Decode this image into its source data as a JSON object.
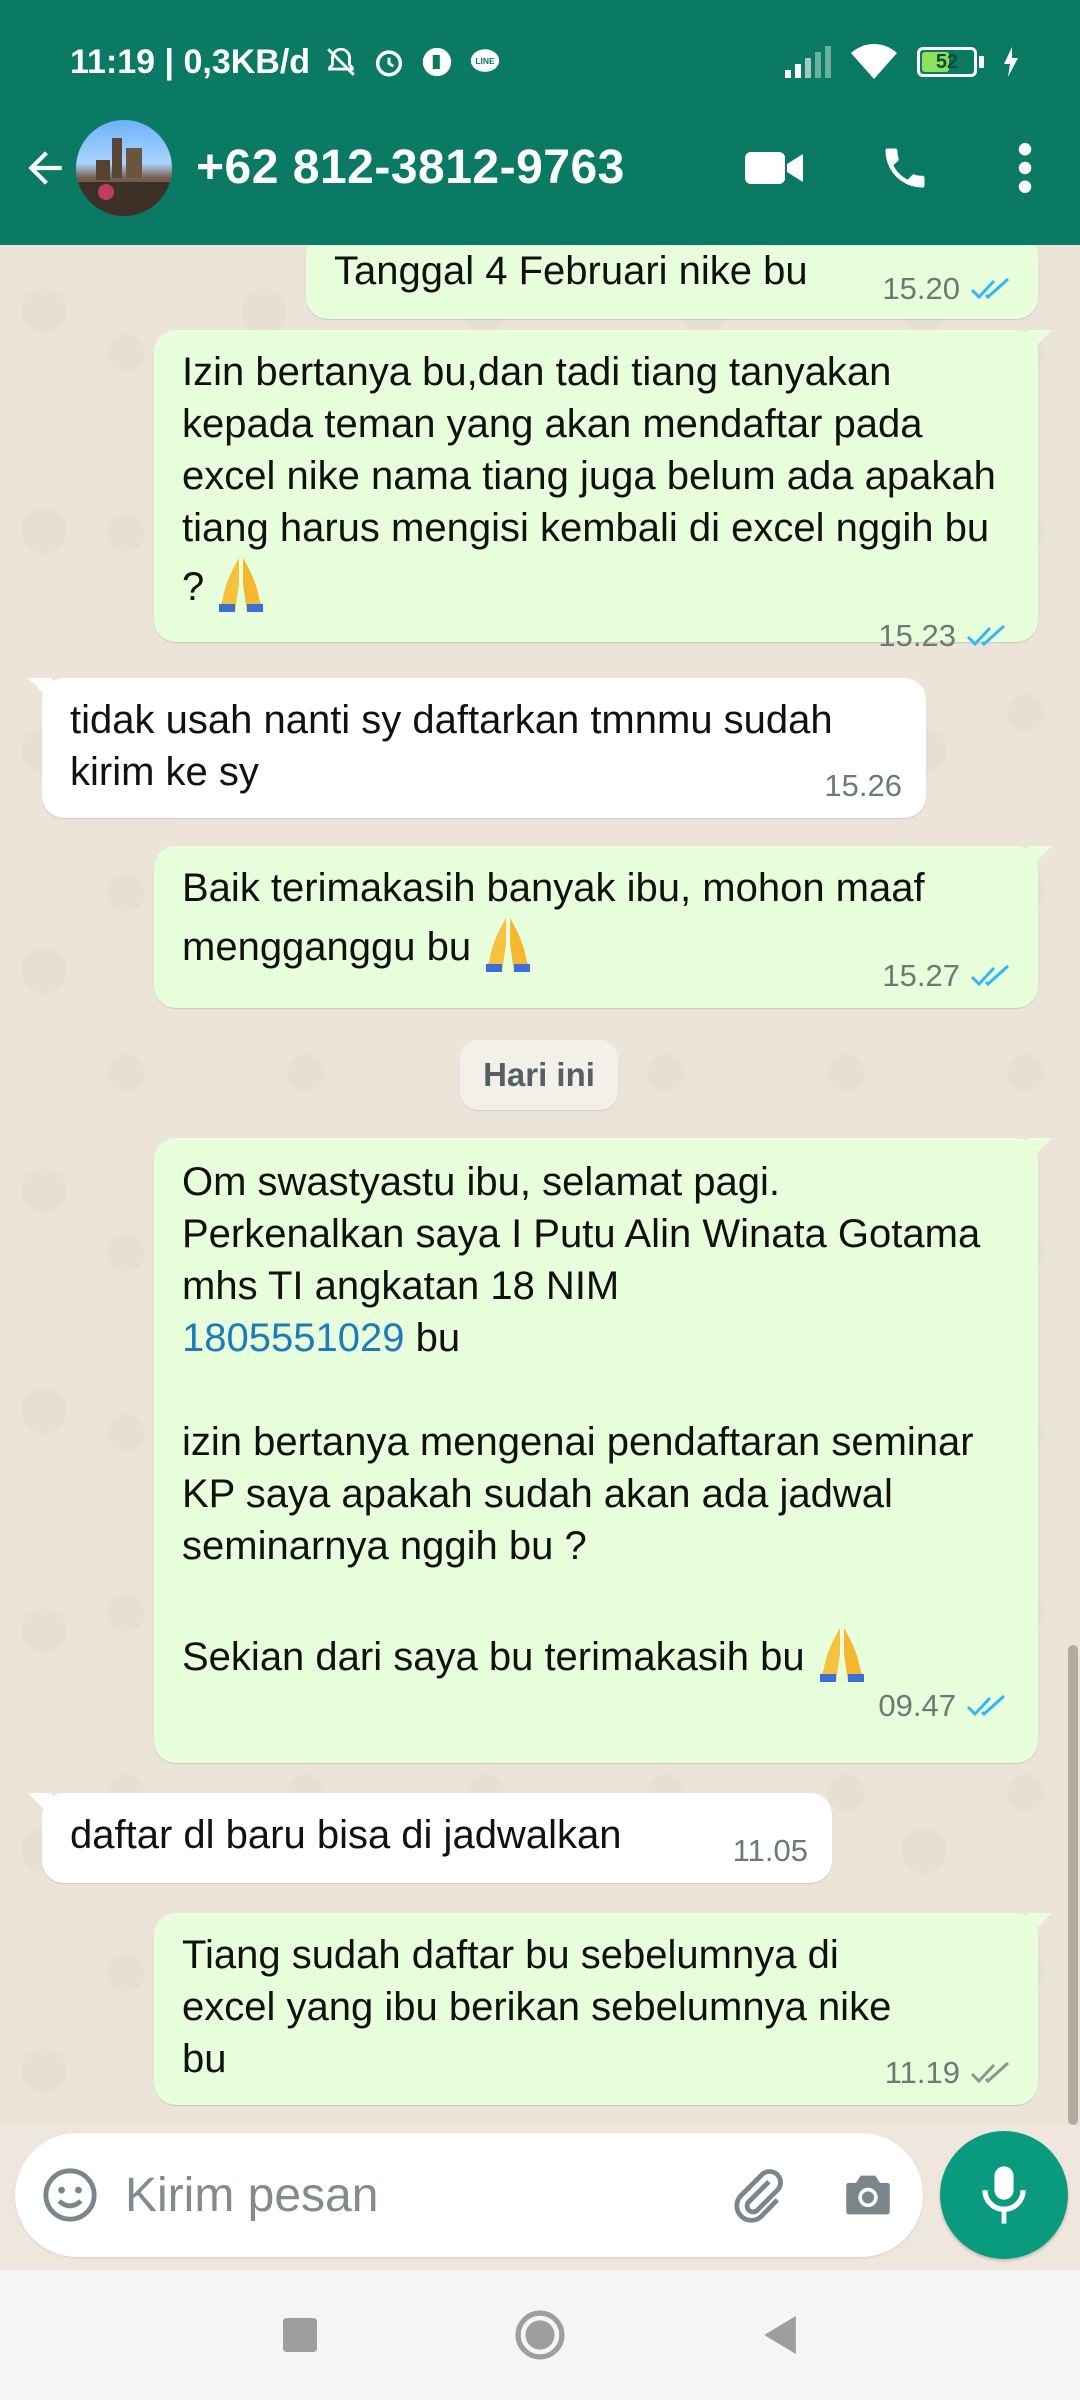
{
  "status_bar": {
    "time_speed": "11:19 | 0,3KB/d",
    "battery": "52",
    "battery_level": 0.52,
    "icons": [
      "mute-bell-icon",
      "alarm-icon",
      "app-icon",
      "line-icon",
      "signal-icon",
      "wifi-icon",
      "battery-icon",
      "charging-icon"
    ]
  },
  "header": {
    "contact": "+62 812-3812-9763",
    "icons": [
      "back-arrow-icon",
      "avatar",
      "video-call-icon",
      "voice-call-icon",
      "more-vert-icon"
    ],
    "color": "#0b7a64"
  },
  "messages": [
    {
      "dir": "out",
      "text": "Tanggal 4 Februari nike bu",
      "time": "15.20",
      "status": "read"
    },
    {
      "dir": "out",
      "text": "Izin bertanya bu,dan tadi tiang tanyakan kepada teman yang akan mendaftar pada excel nike nama tiang juga belum ada apakah tiang harus mengisi kembali di excel nggih bu ?",
      "time": "15.23",
      "status": "read"
    },
    {
      "dir": "in",
      "text": "tidak usah nanti sy daftarkan tmnmu sudah kirim ke sy",
      "time": "15.26"
    },
    {
      "dir": "out",
      "text": "Baik terimakasih banyak ibu, mohon maaf mengganggu bu",
      "time": "15.27",
      "status": "read"
    },
    {
      "dir": "out",
      "text_a": "Om swastyastu ibu, selamat pagi. Perkenalkan saya I Putu Alin Winata Gotama mhs TI angkatan 18 NIM",
      "link": "1805551029",
      "text_b": " bu",
      "text_c": "izin bertanya mengenai pendaftaran seminar KP saya apakah sudah akan ada jadwal seminarnya nggih bu ?",
      "text_d": "Sekian dari saya bu terimakasih bu",
      "time": "09.47",
      "status": "read"
    },
    {
      "dir": "in",
      "text": "daftar dl baru bisa di jadwalkan",
      "time": "11.05"
    },
    {
      "dir": "out",
      "text": "Tiang sudah daftar bu sebelumnya di excel yang ibu berikan sebelumnya nike bu",
      "time": "11.19",
      "status": "delivered"
    }
  ],
  "date_chip": "Hari ini",
  "composer": {
    "placeholder": "Kirim pesan",
    "icons": [
      "emoji-icon",
      "attach-icon",
      "camera-icon",
      "mic-icon"
    ]
  },
  "colors": {
    "outgoing_bubble": "#e7ffdb",
    "incoming_bubble": "#ffffff",
    "read_tick": "#34b7f1",
    "link": "#1f7ab8",
    "mic_button": "#0a9b7e"
  },
  "nav": {
    "icons": [
      "recents-square-icon",
      "home-circle-icon",
      "back-triangle-icon"
    ]
  }
}
